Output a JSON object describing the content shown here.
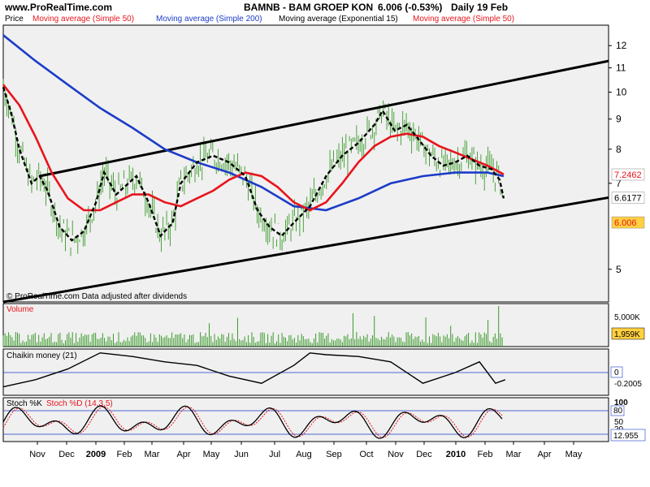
{
  "header": {
    "site": "www.ProRealTime.com",
    "instrument": "BAMNB - BAM GROEP KON",
    "last": "6.006 (-0.53%)",
    "period": "Daily  19 Feb"
  },
  "legend": [
    {
      "label": "Price",
      "color": "#000000"
    },
    {
      "label": "Moving average (Simple 50)",
      "color": "#e8141c"
    },
    {
      "label": "Moving average (Simple 200)",
      "color": "#1c3cc8"
    },
    {
      "label": "Moving average (Exponential 15)",
      "color": "#000000"
    },
    {
      "label": "Moving average (Simple 50)",
      "color": "#e8141c"
    }
  ],
  "copyright": "© ProRealTime.com  Data adjusted after dividends",
  "colors": {
    "price_bars": "#3a9a2a",
    "sma50": "#e8141c",
    "sma200": "#1c3cc8",
    "ema15": "#000000",
    "volume": "#3a9a2a",
    "panel_bg": "#f0f0f0",
    "badge_red": "#e8141c",
    "badge_yellow": "#ffd040"
  },
  "chart_data": [
    {
      "type": "line",
      "title": "Price",
      "y_ticks": [
        5,
        7,
        8,
        9,
        10,
        11,
        12
      ],
      "scale": "log",
      "ylim": [
        4.4,
        13.0
      ],
      "badges": [
        {
          "label": "7.2462",
          "value": 7.2462
        },
        {
          "label": "6.6177",
          "value": 6.6177
        },
        {
          "label": "6.006",
          "value": 6.006
        }
      ],
      "series": [
        {
          "name": "Moving average (Simple 200)",
          "color": "#1c3cc8",
          "points": [
            [
              0,
              12.5
            ],
            [
              40,
              11.3
            ],
            [
              80,
              10.3
            ],
            [
              120,
              9.4
            ],
            [
              160,
              8.7
            ],
            [
              200,
              8.0
            ],
            [
              240,
              7.6
            ],
            [
              280,
              7.3
            ],
            [
              320,
              6.9
            ],
            [
              360,
              6.4
            ],
            [
              400,
              6.3
            ],
            [
              440,
              6.6
            ],
            [
              480,
              7.0
            ],
            [
              520,
              7.2
            ],
            [
              560,
              7.3
            ],
            [
              600,
              7.3
            ],
            [
              620,
              7.2
            ]
          ]
        },
        {
          "name": "Moving average (Simple 50)",
          "color": "#e8141c",
          "points": [
            [
              0,
              10.3
            ],
            [
              20,
              9.5
            ],
            [
              40,
              8.4
            ],
            [
              60,
              7.3
            ],
            [
              80,
              6.6
            ],
            [
              100,
              6.3
            ],
            [
              120,
              6.3
            ],
            [
              140,
              6.5
            ],
            [
              160,
              6.7
            ],
            [
              180,
              6.7
            ],
            [
              200,
              6.5
            ],
            [
              220,
              6.4
            ],
            [
              240,
              6.6
            ],
            [
              260,
              6.8
            ],
            [
              280,
              7.1
            ],
            [
              300,
              7.3
            ],
            [
              320,
              7.2
            ],
            [
              340,
              6.9
            ],
            [
              360,
              6.5
            ],
            [
              380,
              6.3
            ],
            [
              400,
              6.5
            ],
            [
              420,
              7.0
            ],
            [
              440,
              7.6
            ],
            [
              460,
              8.1
            ],
            [
              480,
              8.4
            ],
            [
              500,
              8.5
            ],
            [
              520,
              8.4
            ],
            [
              540,
              8.1
            ],
            [
              560,
              7.9
            ],
            [
              580,
              7.7
            ],
            [
              600,
              7.5
            ],
            [
              620,
              7.25
            ]
          ]
        },
        {
          "name": "Moving average (Exponential 15)",
          "color": "#000000",
          "dashed": true,
          "points": [
            [
              0,
              10.2
            ],
            [
              10,
              9.2
            ],
            [
              20,
              8.0
            ],
            [
              35,
              7.0
            ],
            [
              45,
              7.2
            ],
            [
              55,
              6.8
            ],
            [
              70,
              5.9
            ],
            [
              85,
              5.6
            ],
            [
              100,
              5.8
            ],
            [
              115,
              6.5
            ],
            [
              125,
              7.3
            ],
            [
              140,
              6.7
            ],
            [
              150,
              6.9
            ],
            [
              165,
              7.2
            ],
            [
              180,
              6.5
            ],
            [
              195,
              5.7
            ],
            [
              210,
              6.0
            ],
            [
              220,
              7.0
            ],
            [
              240,
              7.6
            ],
            [
              260,
              7.8
            ],
            [
              280,
              7.6
            ],
            [
              300,
              7.2
            ],
            [
              315,
              6.3
            ],
            [
              330,
              5.9
            ],
            [
              345,
              5.7
            ],
            [
              360,
              6.0
            ],
            [
              380,
              6.4
            ],
            [
              400,
              7.2
            ],
            [
              420,
              7.8
            ],
            [
              440,
              8.2
            ],
            [
              460,
              8.8
            ],
            [
              470,
              9.3
            ],
            [
              485,
              8.6
            ],
            [
              500,
              8.8
            ],
            [
              515,
              8.3
            ],
            [
              530,
              7.8
            ],
            [
              545,
              7.5
            ],
            [
              560,
              7.6
            ],
            [
              575,
              7.8
            ],
            [
              590,
              7.5
            ],
            [
              605,
              7.4
            ],
            [
              615,
              7.1
            ],
            [
              620,
              6.6
            ]
          ]
        }
      ],
      "trendlines": [
        {
          "points": [
            [
              45,
              7.2
            ],
            [
              750,
              11.3
            ]
          ]
        },
        {
          "points": [
            [
              0,
              4.4
            ],
            [
              750,
              6.62
            ]
          ]
        }
      ]
    },
    {
      "type": "bar",
      "title": "Volume",
      "y_ticks": [
        "5,000K"
      ],
      "badges": [
        {
          "label": "1,959K",
          "value": 1959
        }
      ]
    },
    {
      "type": "line",
      "title": "Chaikin money (21)",
      "ylim": [
        -0.5,
        0.5
      ],
      "y_ticks": [
        "0"
      ],
      "badges": [
        {
          "label": "-0.2005",
          "value": -0.2005
        }
      ],
      "series": [
        {
          "name": "Chaikin money (21)",
          "points": [
            [
              0,
              -0.4
            ],
            [
              40,
              -0.2
            ],
            [
              80,
              0.1
            ],
            [
              120,
              0.55
            ],
            [
              160,
              0.45
            ],
            [
              200,
              0.3
            ],
            [
              240,
              0.2
            ],
            [
              280,
              -0.1
            ],
            [
              320,
              -0.3
            ],
            [
              360,
              0.2
            ],
            [
              380,
              0.55
            ],
            [
              400,
              0.5
            ],
            [
              440,
              0.45
            ],
            [
              480,
              0.3
            ],
            [
              520,
              -0.3
            ],
            [
              560,
              0.0
            ],
            [
              590,
              0.3
            ],
            [
              610,
              -0.3
            ],
            [
              622,
              -0.2
            ]
          ]
        }
      ]
    },
    {
      "type": "line",
      "title": "Stoch %K",
      "subtitle": "Stoch %D (14,3,5)",
      "ylim": [
        0,
        100
      ],
      "y_ticks": [
        "100",
        "80",
        "50",
        "20"
      ],
      "badges": [
        {
          "label": "12.955",
          "value": 12.955
        }
      ]
    }
  ],
  "x_axis": {
    "labels": [
      {
        "label": "Nov",
        "pos": 46
      },
      {
        "label": "Dec",
        "pos": 82
      },
      {
        "label": "2009",
        "pos": 118,
        "bold": true
      },
      {
        "label": "Feb",
        "pos": 153
      },
      {
        "label": "Mar",
        "pos": 187
      },
      {
        "label": "Apr",
        "pos": 226
      },
      {
        "label": "May",
        "pos": 260
      },
      {
        "label": "Jun",
        "pos": 297
      },
      {
        "label": "Jul",
        "pos": 338
      },
      {
        "label": "Aug",
        "pos": 374
      },
      {
        "label": "Sep",
        "pos": 411
      },
      {
        "label": "Oct",
        "pos": 451
      },
      {
        "label": "Nov",
        "pos": 487
      },
      {
        "label": "Dec",
        "pos": 522
      },
      {
        "label": "2010",
        "pos": 561,
        "bold": true
      },
      {
        "label": "Feb",
        "pos": 597
      },
      {
        "label": "Mar",
        "pos": 632
      },
      {
        "label": "Apr",
        "pos": 670
      },
      {
        "label": "May",
        "pos": 706
      }
    ]
  }
}
